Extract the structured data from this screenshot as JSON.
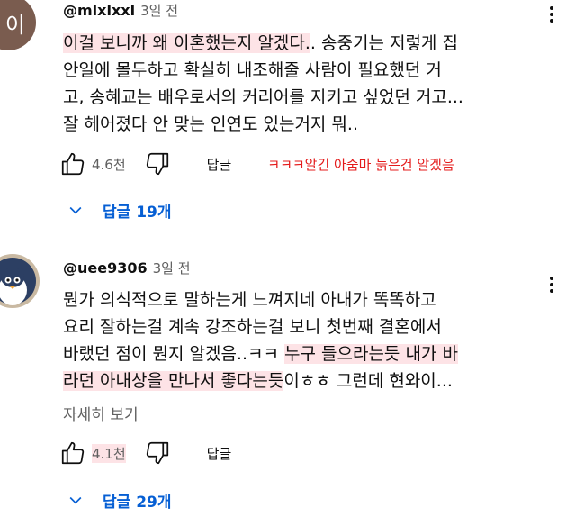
{
  "comments": [
    {
      "avatar_letter": "이",
      "avatar_color": "#7a5c4f",
      "handle": "@mlxlxxl",
      "time": "3일 전",
      "lines": [
        [
          {
            "t": "이걸 보니까 왜 이혼했는지 알겠다.",
            "hl": true
          },
          {
            "t": ". 송중기는 저렇게 집",
            "hl": false
          }
        ],
        [
          {
            "t": "안일에 몰두하고 확실히 내조해줄 사람이 필요했던 거",
            "hl": false
          }
        ],
        [
          {
            "t": "고, 송혜교는 배우로서의 커리어를 지키고 싶었던 거고...",
            "hl": false
          }
        ],
        [
          {
            "t": "잘 헤어졌다 안 맞는 인연도 있는거지 뭐..",
            "hl": false
          }
        ]
      ],
      "likes": "4.6천",
      "reply_label": "답글",
      "annotation": "ㅋㅋㅋ알긴 아줌마 늙은건 알겠음",
      "replies_label": "답글 19개"
    },
    {
      "handle": "@uee9306",
      "time": "3일 전",
      "lines": [
        [
          {
            "t": "뭔가 의식적으로 말하는게 느껴지네 아내가 똑똑하고",
            "hl": false
          }
        ],
        [
          {
            "t": "요리 잘하는걸 계속 강조하는걸 보니 첫번째 결혼에서",
            "hl": false
          }
        ],
        [
          {
            "t": "바랬던 점이 뭔지 알겠음..ㅋㅋ ",
            "hl": false
          },
          {
            "t": "누구 들으라는듯 내가 바",
            "hl": true
          }
        ],
        [
          {
            "t": "라던 아내상을 만나서 좋다는듯",
            "hl": true
          },
          {
            "t": "이ㅎㅎ 그런데 현와이...",
            "hl": false
          }
        ]
      ],
      "more_label": "자세히 보기",
      "likes": "4.1천",
      "reply_label": "답글",
      "replies_label": "답글 29개"
    }
  ],
  "colors": {
    "link_blue": "#065fd4",
    "annotation_red": "#e41b1b",
    "highlight_pink": "#fde3e6"
  }
}
